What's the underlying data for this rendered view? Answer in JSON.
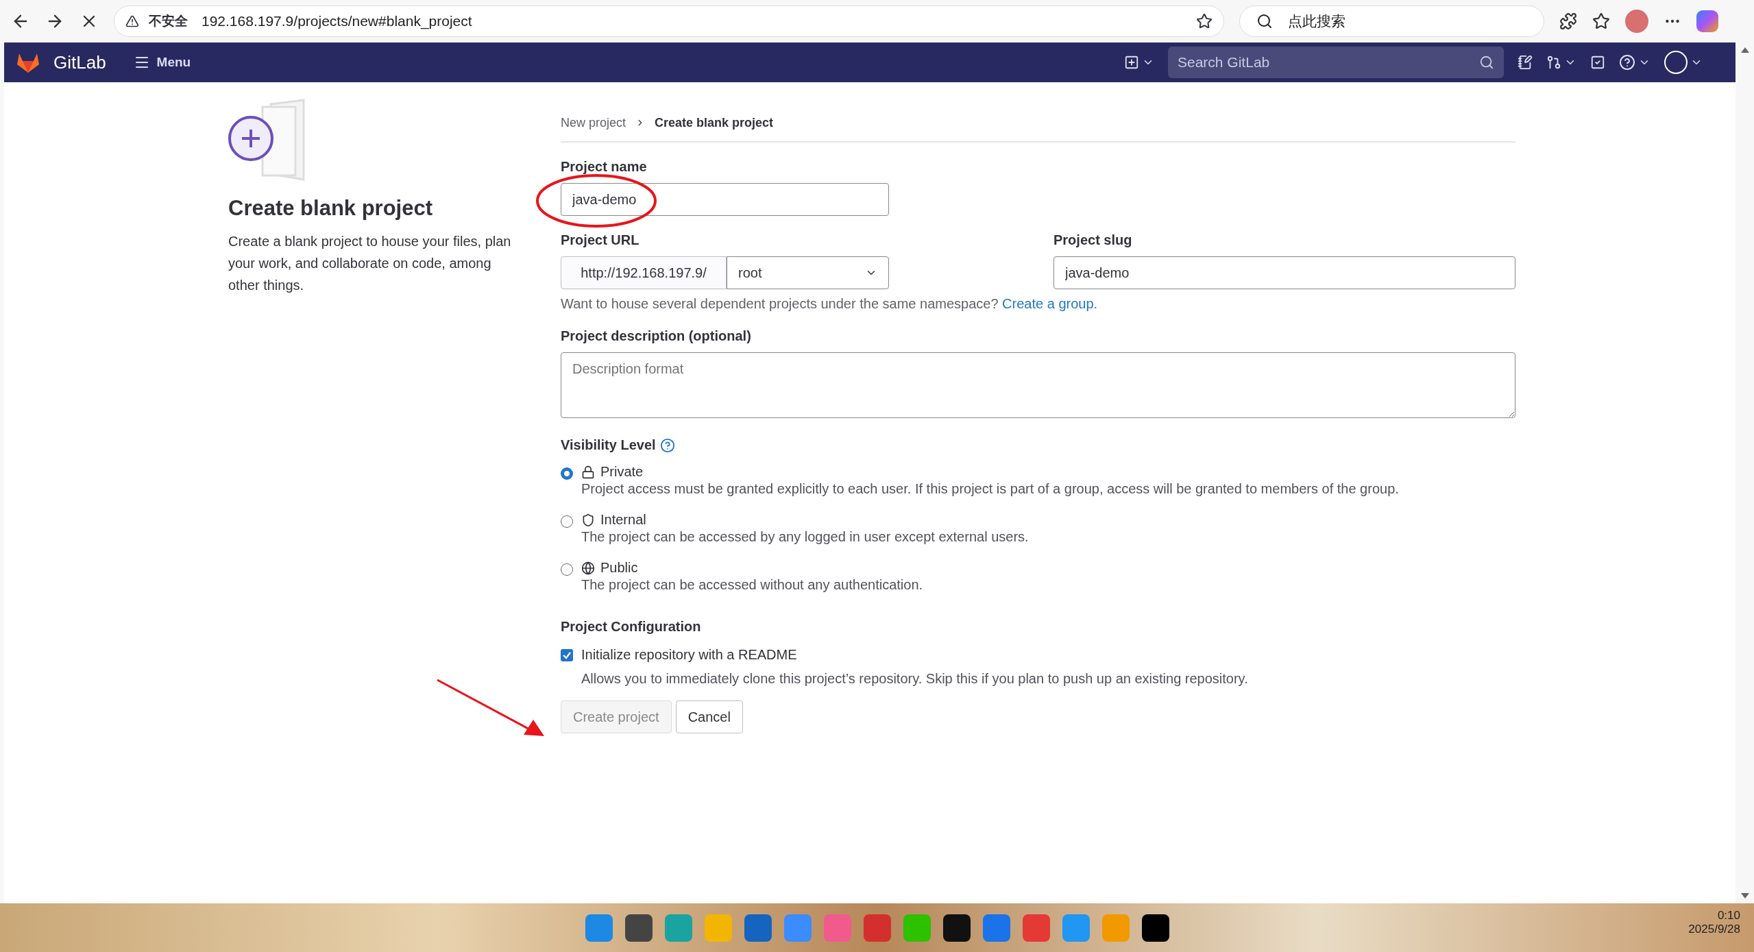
{
  "browser": {
    "security": "不安全",
    "url": "192.168.197.9/projects/new#blank_project",
    "search_placeholder": "点此搜索"
  },
  "header": {
    "brand": "GitLab",
    "menu": "Menu",
    "search_placeholder": "Search GitLab"
  },
  "intro": {
    "title": "Create blank project",
    "description": "Create a blank project to house your files, plan your work, and collaborate on code, among other things."
  },
  "breadcrumbs": [
    {
      "label": "New project",
      "current": false
    },
    {
      "label": "Create blank project",
      "current": true
    }
  ],
  "form": {
    "name_label": "Project name",
    "name_value": "java-demo",
    "url_label": "Project URL",
    "url_prefix": "http://192.168.197.9/",
    "namespace": "root",
    "slug_label": "Project slug",
    "slug_value": "java-demo",
    "group_hint": "Want to house several dependent projects under the same namespace?",
    "group_link": "Create a group.",
    "description_label": "Project description (optional)",
    "description_placeholder": "Description format"
  },
  "visibility": {
    "label": "Visibility Level",
    "options": [
      {
        "kind": "lock",
        "label": "Private",
        "description": "Project access must be granted explicitly to each user. If this project is part of a group, access will be granted to members of the group.",
        "selected": true
      },
      {
        "kind": "shield",
        "label": "Internal",
        "description": "The project can be accessed by any logged in user except external users.",
        "selected": false
      },
      {
        "kind": "globe",
        "label": "Public",
        "description": "The project can be accessed without any authentication.",
        "selected": false
      }
    ]
  },
  "configuration": {
    "label": "Project Configuration",
    "readme_label": "Initialize repository with a README",
    "readme_checked": true,
    "readme_help": "Allows you to immediately clone this project’s repository. Skip this if you plan to push up an existing repository."
  },
  "buttons": [
    {
      "label": "Create project",
      "disabled": true
    },
    {
      "label": "Cancel",
      "disabled": false
    }
  ],
  "taskbar": {
    "apps": [
      {
        "color": "#1e88e5"
      },
      {
        "color": "#444444"
      },
      {
        "color": "#1aa3a0"
      },
      {
        "color": "#f2b600"
      },
      {
        "color": "#1565c0"
      },
      {
        "color": "#3b8cff"
      },
      {
        "color": "#f05a8c"
      },
      {
        "color": "#d32f2f"
      },
      {
        "color": "#2dc100"
      },
      {
        "color": "#111111"
      },
      {
        "color": "#1a73e8"
      },
      {
        "color": "#e53935"
      },
      {
        "color": "#2196f3"
      },
      {
        "color": "#f29900"
      },
      {
        "color": "#000000"
      }
    ],
    "time": "0:10",
    "date": "2025/9/28"
  }
}
